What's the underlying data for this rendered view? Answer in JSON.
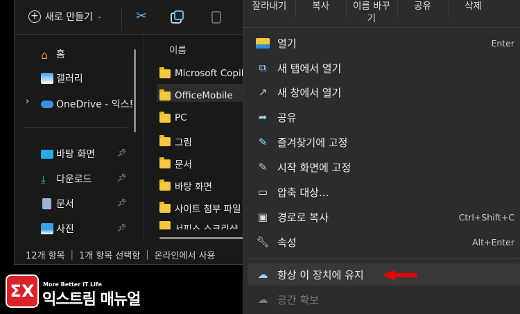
{
  "toolbar": {
    "new_label": "새로 만들기"
  },
  "nav": {
    "items": [
      {
        "label": "홈",
        "icon": "home-icon"
      },
      {
        "label": "갤러리",
        "icon": "gallery-icon"
      },
      {
        "label": "OneDrive - 익스트",
        "icon": "onedrive-icon"
      },
      {
        "label": "바탕 화면",
        "icon": "desktop-icon",
        "pinned": true
      },
      {
        "label": "다운로드",
        "icon": "download-icon",
        "pinned": true
      },
      {
        "label": "문서",
        "icon": "document-icon",
        "pinned": true
      },
      {
        "label": "사진",
        "icon": "pictures-icon",
        "pinned": true
      }
    ]
  },
  "files": {
    "header": "이름",
    "items": [
      "Microsoft Copilot",
      "OfficeMobile",
      "PC",
      "그림",
      "문서",
      "바탕 화면",
      "사이트 첨부 파일",
      "서피스 스크리샷"
    ],
    "selected": "OfficeMobile"
  },
  "status": {
    "count": "12개 항목",
    "selected": "1개 항목 선택함",
    "online": "온라인에서 사용"
  },
  "menu": {
    "top": [
      "잘라내기",
      "복사",
      "이름 바꾸기",
      "공유",
      "삭제"
    ],
    "items": [
      {
        "label": "열기",
        "shortcut": "Enter",
        "icon": "folder-open-icon"
      },
      {
        "label": "새 탭에서 열기",
        "shortcut": "",
        "icon": "new-tab-icon"
      },
      {
        "label": "새 창에서 열기",
        "shortcut": "",
        "icon": "new-window-icon"
      },
      {
        "label": "공유",
        "shortcut": "",
        "icon": "share-icon"
      },
      {
        "label": "즐겨찾기에 고정",
        "shortcut": "",
        "icon": "pin-icon"
      },
      {
        "label": "시작 화면에 고정",
        "shortcut": "",
        "icon": "pin-icon"
      },
      {
        "label": "압축 대상...",
        "shortcut": "",
        "icon": "zip-folder-icon"
      },
      {
        "label": "경로로 복사",
        "shortcut": "Ctrl+Shift+C",
        "icon": "copy-path-icon"
      },
      {
        "label": "속성",
        "shortcut": "Alt+Enter",
        "icon": "wrench-icon"
      }
    ],
    "keep": {
      "label": "항상 이 장치에 유지",
      "icon": "cloud-download-icon"
    },
    "free": {
      "label": "공간 확보",
      "icon": "cloud-icon"
    }
  },
  "logo": {
    "tagline": "More Better IT Life",
    "name": "익스트림 매뉴얼"
  },
  "colors": {
    "accent": "#60b8f0",
    "arrow": "#e8000b",
    "logo": "#d8232a"
  }
}
